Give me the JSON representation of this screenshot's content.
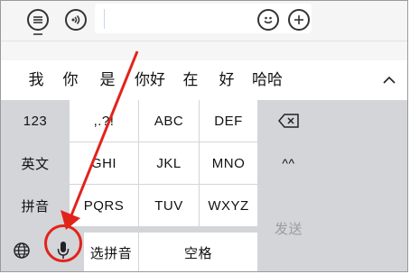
{
  "topbar": {
    "left_icons": [
      "list-bubble-icon",
      "voice-bubble-icon"
    ],
    "right_icons": [
      "smiley-icon",
      "plus-icon"
    ],
    "input_value": ""
  },
  "candidates": [
    "我",
    "你",
    "是",
    "你好",
    "在",
    "好",
    "哈哈"
  ],
  "keyboard": {
    "row1": {
      "left": "123",
      "keys": [
        ",.?!",
        "ABC",
        "DEF"
      ]
    },
    "row2": {
      "left": "英文",
      "keys": [
        "GHI",
        "JKL",
        "MNO"
      ],
      "right": "^^"
    },
    "row3": {
      "left": "拼音",
      "keys": [
        "PQRS",
        "TUV",
        "WXYZ"
      ]
    },
    "row4": {
      "select_pinyin": "选拼音",
      "space": "空格"
    },
    "send": "发送"
  },
  "annotation": {
    "color": "#e2231a",
    "target": "microphone-key"
  }
}
